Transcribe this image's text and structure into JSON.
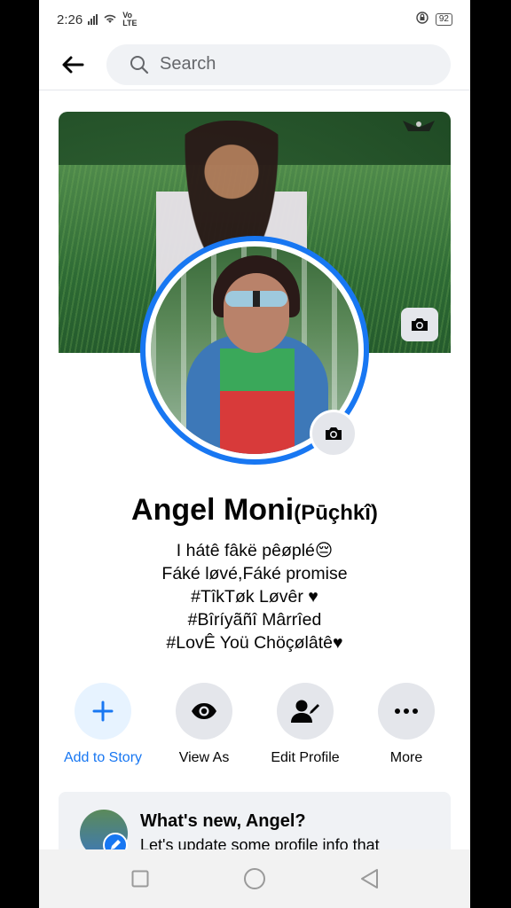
{
  "status_bar": {
    "time": "2:26",
    "network": "Vo LTE",
    "battery": "92"
  },
  "header": {
    "search_placeholder": "Search"
  },
  "profile": {
    "name": "Angel Moni",
    "alt_name": "(Pūçhkî)",
    "bio": [
      "I hátê fâkë pêøplé😔",
      "Fáké løvé,Fáké promise",
      "#TîkTøk Løvêr ♥",
      "#Bîríyãñî Mârrîed",
      "#LovÊ Yoü Chöçølâtê♥"
    ]
  },
  "actions": [
    {
      "label": "Add to Story",
      "icon": "plus-icon"
    },
    {
      "label": "View As",
      "icon": "eye-icon"
    },
    {
      "label": "Edit Profile",
      "icon": "edit-person-icon"
    },
    {
      "label": "More",
      "icon": "more-dots-icon"
    }
  ],
  "whats_new": {
    "title": "What's new, Angel?",
    "subtitle": "Let's update some profile info that"
  },
  "colors": {
    "accent": "#1877f2",
    "button_bg": "#e4e6eb",
    "text": "#050505"
  }
}
